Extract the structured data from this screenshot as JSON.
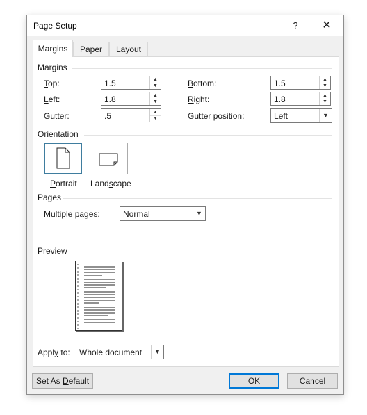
{
  "dialog": {
    "title": "Page Setup",
    "help_label": "?",
    "close_label": "✕"
  },
  "tabs": [
    {
      "label": "Margins",
      "active": true
    },
    {
      "label": "Paper",
      "active": false
    },
    {
      "label": "Layout",
      "active": false
    }
  ],
  "margins": {
    "group_label": "Margins",
    "top": {
      "label_u": "T",
      "label_rest": "op:",
      "value": "1.5"
    },
    "bottom": {
      "label_u": "B",
      "label_rest": "ottom:",
      "value": "1.5"
    },
    "left": {
      "label_u": "L",
      "label_rest": "eft:",
      "value": "1.8"
    },
    "right": {
      "label_u": "R",
      "label_rest": "ight:",
      "value": "1.8"
    },
    "gutter": {
      "label_u": "G",
      "label_rest": "utter:",
      "value": ".5"
    },
    "gutter_position": {
      "label_pre": "G",
      "label_u": "u",
      "label_rest": "tter position:",
      "value": "Left"
    }
  },
  "orientation": {
    "group_label": "Orientation",
    "portrait": {
      "label_u": "P",
      "label_rest": "ortrait",
      "selected": true
    },
    "landscape": {
      "label_pre": "Land",
      "label_u": "s",
      "label_rest": "cape",
      "selected": false
    }
  },
  "pages": {
    "group_label": "Pages",
    "multiple_pages": {
      "label_u": "M",
      "label_rest": "ultiple pages:",
      "value": "Normal"
    }
  },
  "preview": {
    "group_label": "Preview"
  },
  "apply_to": {
    "label_pre": "Appl",
    "label_u": "y",
    "label_rest": " to:",
    "value": "Whole document"
  },
  "buttons": {
    "set_default": {
      "label_pre": "Set As ",
      "label_u": "D",
      "label_rest": "efault"
    },
    "ok": "OK",
    "cancel": "Cancel"
  },
  "colors": {
    "accent": "#0078d7",
    "dialog_bg": "#f0f0f0",
    "panel_bg": "#ffffff"
  }
}
